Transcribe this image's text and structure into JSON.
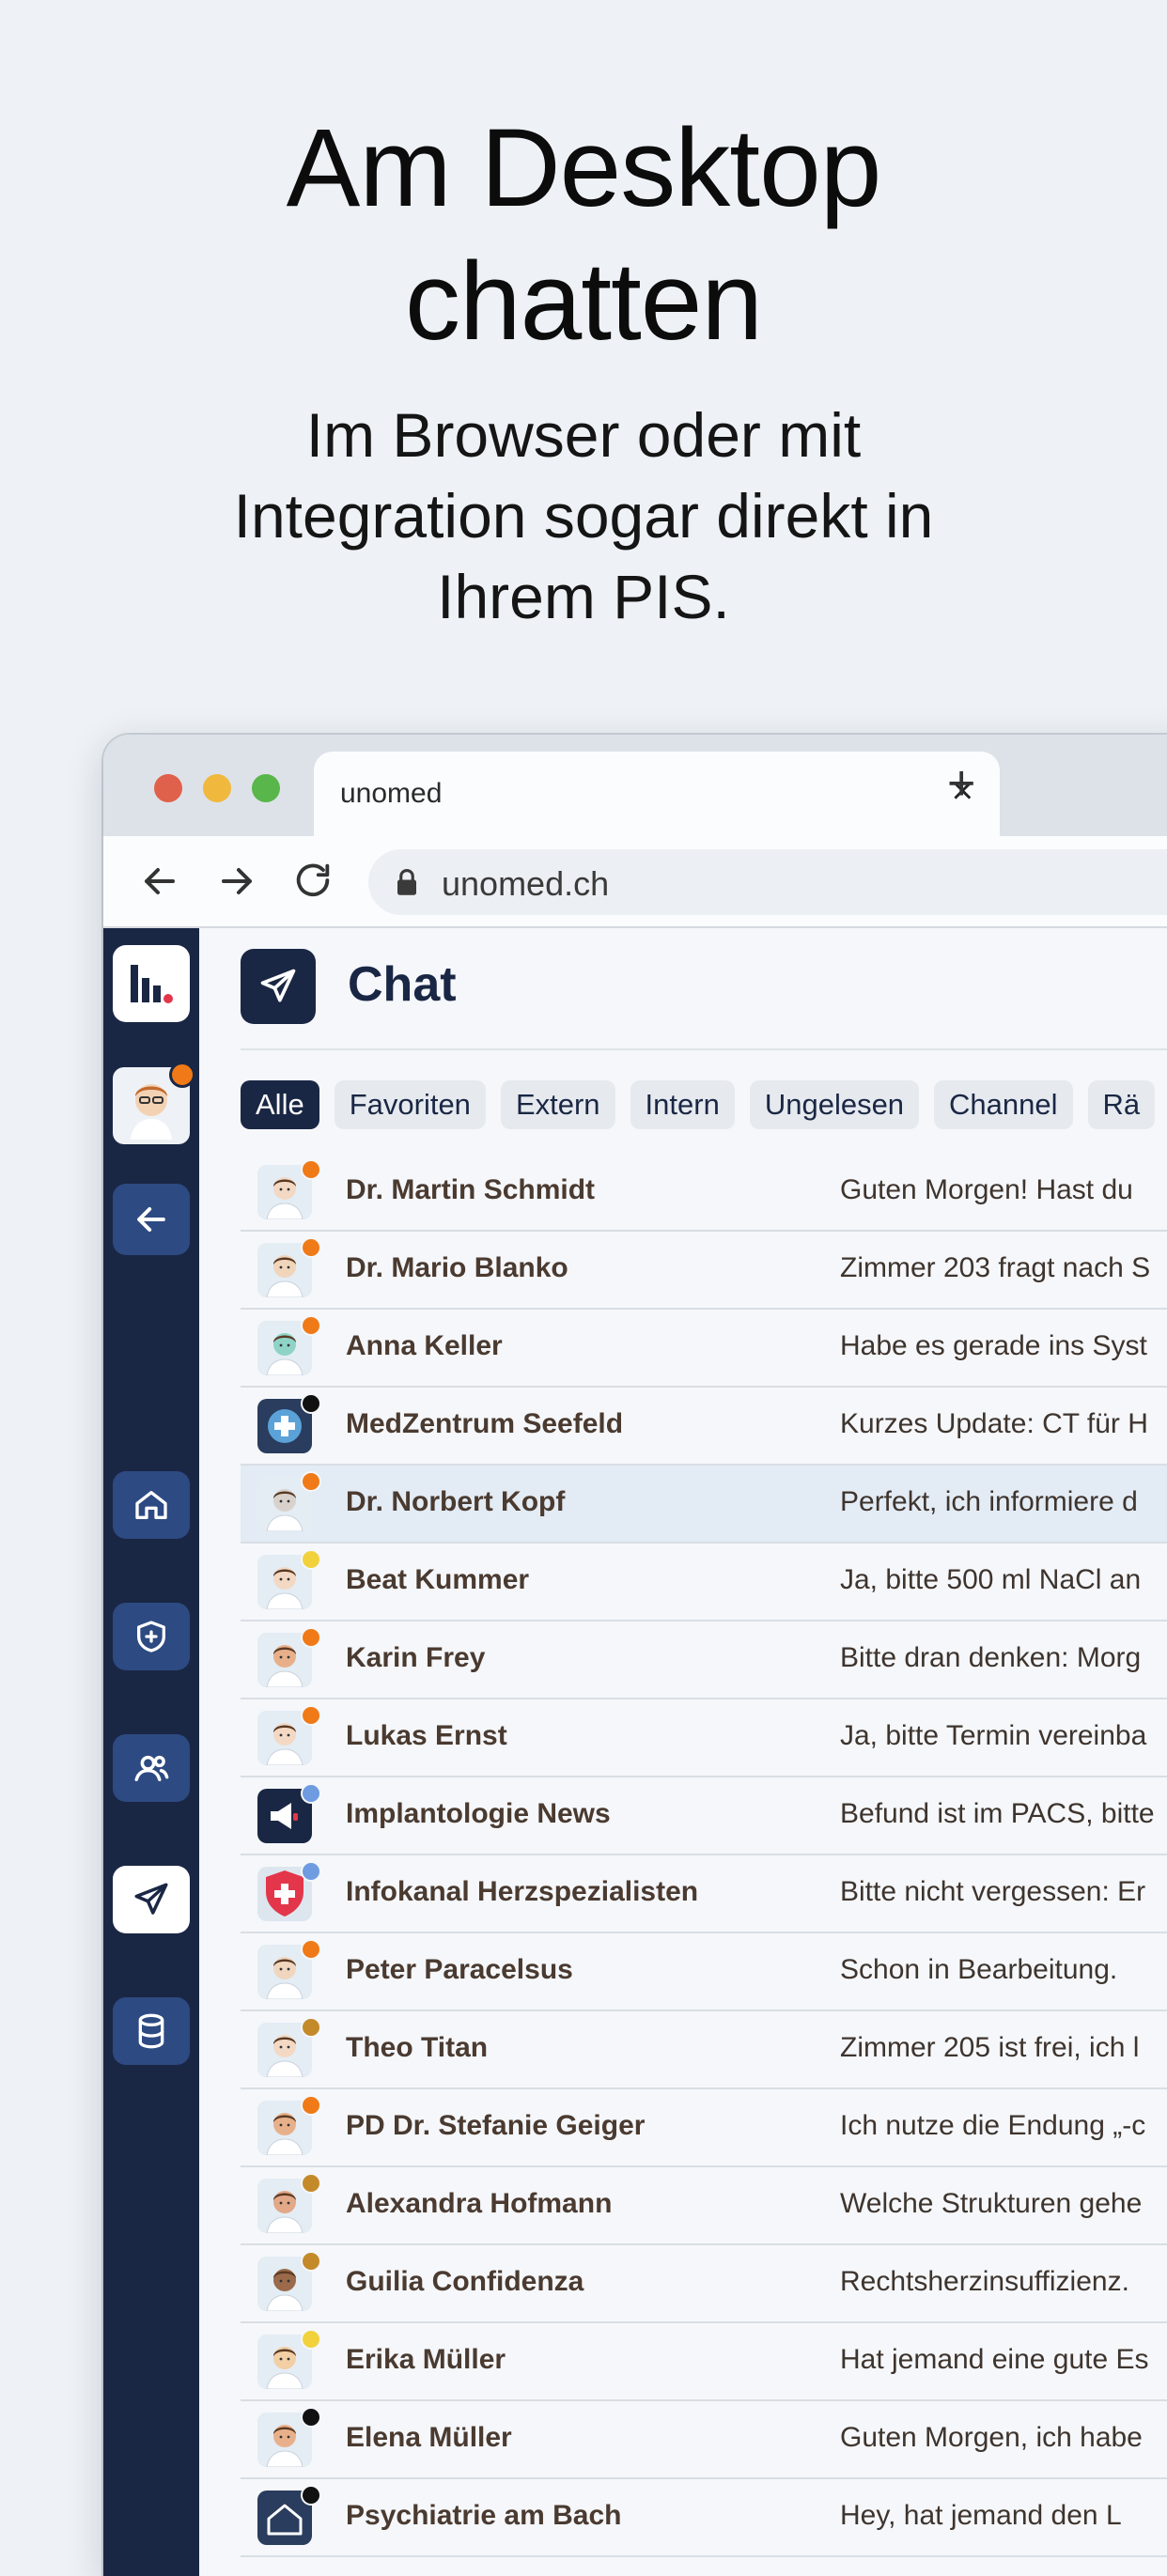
{
  "hero": {
    "title_line1": "Am Desktop",
    "title_line2": "chatten",
    "sub_line1": "Im Browser oder mit",
    "sub_line2": "Integration sogar direkt in",
    "sub_line3": "Ihrem PIS."
  },
  "browser": {
    "tab_label": "unomed",
    "url": "unomed.ch"
  },
  "chat": {
    "title": "Chat",
    "filters": [
      "Alle",
      "Favoriten",
      "Extern",
      "Intern",
      "Ungelesen",
      "Channel",
      "Rä"
    ],
    "rows": [
      {
        "name": "Dr. Martin Schmidt",
        "preview": "Guten Morgen! Hast du",
        "status": "#f07a17",
        "avatar": "person",
        "color": "#f3d9c4"
      },
      {
        "name": "Dr. Mario Blanko",
        "preview": "Zimmer 203 fragt nach S",
        "status": "#f07a17",
        "avatar": "person",
        "color": "#f1d5bb"
      },
      {
        "name": "Anna Keller",
        "preview": "Habe es gerade ins Syst",
        "status": "#f07a17",
        "avatar": "person",
        "color": "#8ed3c6"
      },
      {
        "name": "MedZentrum Seefeld",
        "preview": "Kurzes Update: CT für H",
        "status": "#111111",
        "avatar": "clinic",
        "color": "#2a3d5e"
      },
      {
        "name": "Dr. Norbert Kopf",
        "preview": "Perfekt, ich informiere d",
        "status": "#f07a17",
        "avatar": "person",
        "color": "#d9d2cc"
      },
      {
        "name": "Beat Kummer",
        "preview": "Ja, bitte 500 ml NaCl an",
        "status": "#f2d23c",
        "avatar": "person",
        "color": "#f3d9c4"
      },
      {
        "name": "Karin Frey",
        "preview": "Bitte dran denken: Morg",
        "status": "#f07a17",
        "avatar": "person",
        "color": "#e8b08a"
      },
      {
        "name": "Lukas Ernst",
        "preview": "Ja, bitte Termin vereinba",
        "status": "#f07a17",
        "avatar": "person",
        "color": "#f3d9c4"
      },
      {
        "name": "Implantologie News",
        "preview": "Befund ist im PACS, bitte",
        "status": "#6f9be0",
        "avatar": "megaphone",
        "color": "#1a2744"
      },
      {
        "name": "Infokanal Herzspezialisten",
        "preview": "Bitte nicht vergessen: Er",
        "status": "#6f9be0",
        "avatar": "shield",
        "color": "#e3364a"
      },
      {
        "name": "Peter Paracelsus",
        "preview": "Schon in Bearbeitung.",
        "status": "#f07a17",
        "avatar": "person",
        "color": "#f0d6be"
      },
      {
        "name": "Theo Titan",
        "preview": "Zimmer 205 ist frei, ich l",
        "status": "#c48a2a",
        "avatar": "person",
        "color": "#f3d9c4"
      },
      {
        "name": "PD Dr. Stefanie Geiger",
        "preview": "Ich nutze die Endung „-c",
        "status": "#f07a17",
        "avatar": "person",
        "color": "#e8b08a"
      },
      {
        "name": "Alexandra Hofmann",
        "preview": "Welche Strukturen gehe",
        "status": "#c48a2a",
        "avatar": "person",
        "color": "#e2a887"
      },
      {
        "name": "Guilia Confidenza",
        "preview": "Rechtsherzinsuffizienz.",
        "status": "#c48a2a",
        "avatar": "person",
        "color": "#9a6a4a"
      },
      {
        "name": "Erika Müller",
        "preview": "Hat jemand eine gute Es",
        "status": "#f2d23c",
        "avatar": "person",
        "color": "#f2cfa4"
      },
      {
        "name": "Elena Müller",
        "preview": "Guten Morgen, ich habe",
        "status": "#111111",
        "avatar": "person",
        "color": "#e8b08a"
      },
      {
        "name": "Psychiatrie am Bach",
        "preview": "Hey, hat jemand den L",
        "status": "#111111",
        "avatar": "home",
        "color": "#2a3d5e"
      }
    ]
  }
}
